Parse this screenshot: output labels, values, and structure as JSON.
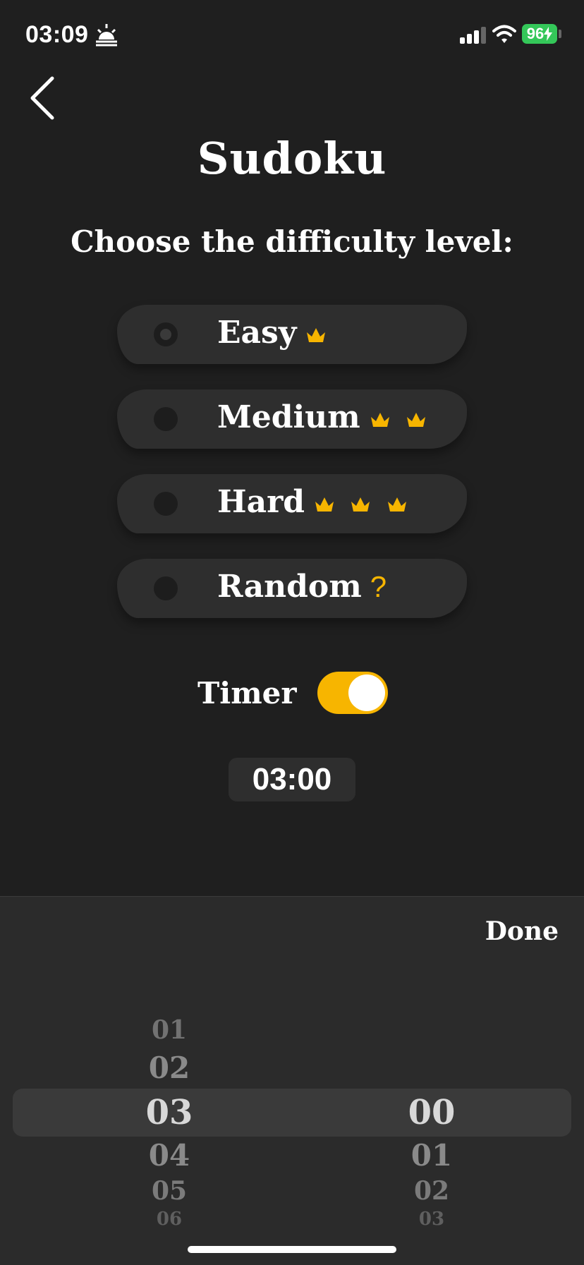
{
  "status_bar": {
    "time": "03:09",
    "battery": "96"
  },
  "header": {
    "title": "Sudoku",
    "subtitle": "Choose the difficulty level:"
  },
  "options": [
    {
      "label": "Easy",
      "crowns": 1,
      "selected": true
    },
    {
      "label": "Medium",
      "crowns": 2,
      "selected": false
    },
    {
      "label": "Hard",
      "crowns": 3,
      "selected": false
    },
    {
      "label": "Random",
      "crowns": 0,
      "suffix": "?",
      "selected": false
    }
  ],
  "timer": {
    "label": "Timer",
    "enabled": true,
    "value": "03:00"
  },
  "picker": {
    "done_label": "Done",
    "minutes": [
      "01",
      "02",
      "03",
      "04",
      "05",
      "06"
    ],
    "seconds": [
      "00",
      "01",
      "02",
      "03"
    ]
  },
  "colors": {
    "accent": "#f7b500",
    "background": "#1f1f1f",
    "card": "#2e2e2e",
    "panel": "#2b2b2b",
    "battery": "#34c759"
  },
  "icons": {
    "back": "chevron-left-icon",
    "crown": "crown-icon",
    "status": "sunrise-icon"
  }
}
